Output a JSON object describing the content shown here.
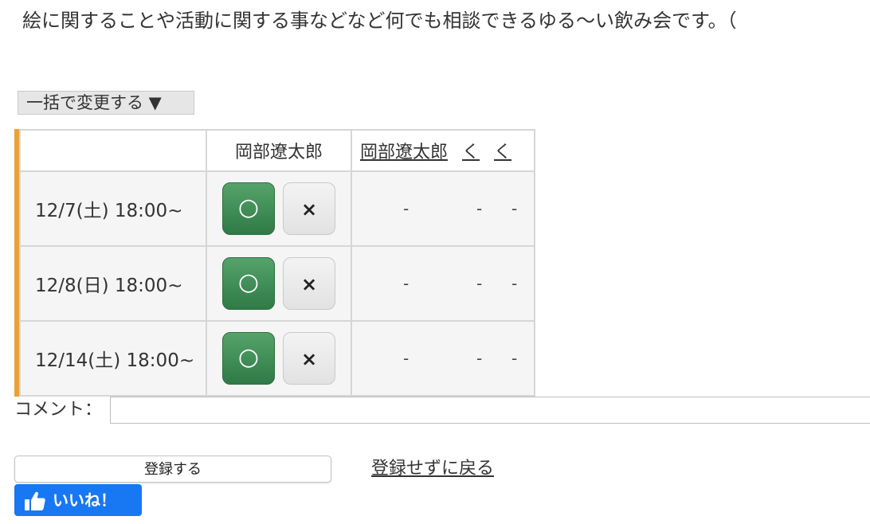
{
  "event": {
    "description": "絵に関することや活動に関する事などなど何でも相談できるゆる〜い飲み会です。（"
  },
  "bulk_change": {
    "label": "一括で変更する ▼"
  },
  "schedule": {
    "own_name": "岡部遼太郎",
    "other_headers": [
      "岡部遼太郎",
      "く",
      "く"
    ],
    "yes_label": "○",
    "no_label": "×",
    "rows": [
      {
        "date": "12/7(土) 18:00~",
        "others": [
          "-",
          "-",
          "-"
        ]
      },
      {
        "date": "12/8(日) 18:00~",
        "others": [
          "-",
          "-",
          "-"
        ]
      },
      {
        "date": "12/14(土) 18:00~",
        "others": [
          "-",
          "-",
          "-"
        ]
      }
    ]
  },
  "comment": {
    "label": "コメント：",
    "value": "",
    "placeholder": ""
  },
  "actions": {
    "submit_label": "登録する",
    "back_label": "登録せずに戻る",
    "like_label": "いいね！"
  },
  "colors": {
    "accent_bar": "#e8a23a",
    "yes_button": "#3d8b55",
    "like_button": "#1877f2"
  },
  "icons": {
    "like": "thumbs-up-icon"
  }
}
